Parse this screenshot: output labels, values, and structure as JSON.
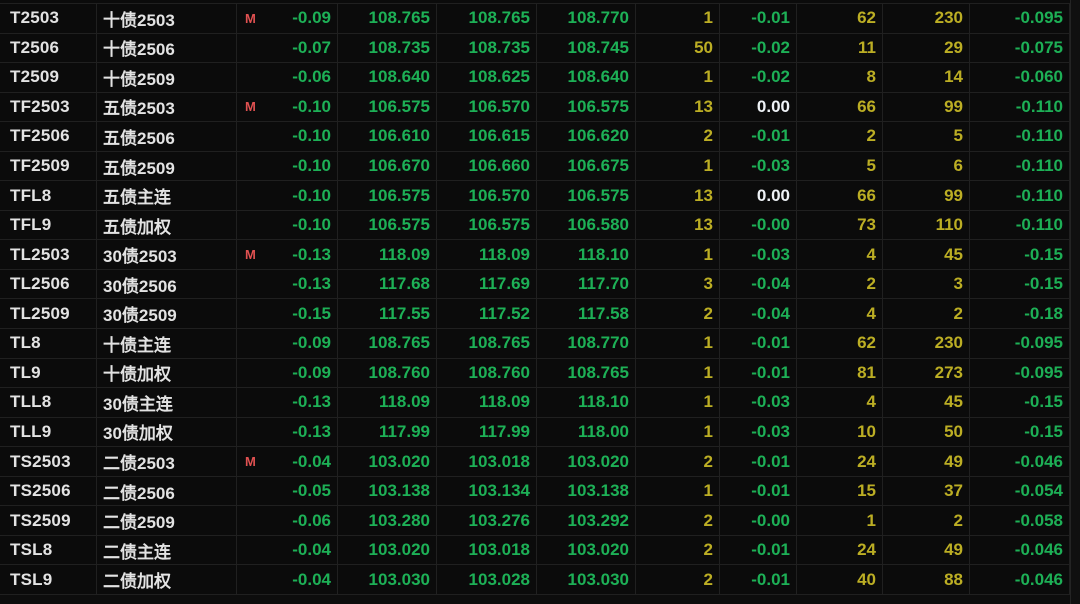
{
  "colors": {
    "background": "#0b0b0b",
    "grid_line": "#202020",
    "text_primary": "#e3e3e3",
    "down_green": "#1db056",
    "volume_yellow": "#bcae24",
    "zero_white": "#eef2f6",
    "marker_red": "#e05151",
    "scrollbar_track": "#101010",
    "footer": "#0d0d0d"
  },
  "marker_glyph": "M",
  "rows": [
    {
      "code": "T2503",
      "name": "十债2503",
      "marker": "M",
      "change": "-0.09",
      "price1": "108.765",
      "price2": "108.765",
      "price3": "108.770",
      "vol": "1",
      "change2": "-0.01",
      "num1": "62",
      "num2": "230",
      "change3": "-0.095"
    },
    {
      "code": "T2506",
      "name": "十债2506",
      "marker": "",
      "change": "-0.07",
      "price1": "108.735",
      "price2": "108.735",
      "price3": "108.745",
      "vol": "50",
      "change2": "-0.02",
      "num1": "11",
      "num2": "29",
      "change3": "-0.075"
    },
    {
      "code": "T2509",
      "name": "十债2509",
      "marker": "",
      "change": "-0.06",
      "price1": "108.640",
      "price2": "108.625",
      "price3": "108.640",
      "vol": "1",
      "change2": "-0.02",
      "num1": "8",
      "num2": "14",
      "change3": "-0.060"
    },
    {
      "code": "TF2503",
      "name": "五债2503",
      "marker": "M",
      "change": "-0.10",
      "price1": "106.575",
      "price2": "106.570",
      "price3": "106.575",
      "vol": "13",
      "change2": "0.00",
      "num1": "66",
      "num2": "99",
      "change3": "-0.110"
    },
    {
      "code": "TF2506",
      "name": "五债2506",
      "marker": "",
      "change": "-0.10",
      "price1": "106.610",
      "price2": "106.615",
      "price3": "106.620",
      "vol": "2",
      "change2": "-0.01",
      "num1": "2",
      "num2": "5",
      "change3": "-0.110"
    },
    {
      "code": "TF2509",
      "name": "五债2509",
      "marker": "",
      "change": "-0.10",
      "price1": "106.670",
      "price2": "106.660",
      "price3": "106.675",
      "vol": "1",
      "change2": "-0.03",
      "num1": "5",
      "num2": "6",
      "change3": "-0.110"
    },
    {
      "code": "TFL8",
      "name": "五债主连",
      "marker": "",
      "change": "-0.10",
      "price1": "106.575",
      "price2": "106.570",
      "price3": "106.575",
      "vol": "13",
      "change2": "0.00",
      "num1": "66",
      "num2": "99",
      "change3": "-0.110"
    },
    {
      "code": "TFL9",
      "name": "五债加权",
      "marker": "",
      "change": "-0.10",
      "price1": "106.575",
      "price2": "106.575",
      "price3": "106.580",
      "vol": "13",
      "change2": "-0.00",
      "num1": "73",
      "num2": "110",
      "change3": "-0.110"
    },
    {
      "code": "TL2503",
      "name": "30债2503",
      "marker": "M",
      "change": "-0.13",
      "price1": "118.09",
      "price2": "118.09",
      "price3": "118.10",
      "vol": "1",
      "change2": "-0.03",
      "num1": "4",
      "num2": "45",
      "change3": "-0.15"
    },
    {
      "code": "TL2506",
      "name": "30债2506",
      "marker": "",
      "change": "-0.13",
      "price1": "117.68",
      "price2": "117.69",
      "price3": "117.70",
      "vol": "3",
      "change2": "-0.04",
      "num1": "2",
      "num2": "3",
      "change3": "-0.15"
    },
    {
      "code": "TL2509",
      "name": "30债2509",
      "marker": "",
      "change": "-0.15",
      "price1": "117.55",
      "price2": "117.52",
      "price3": "117.58",
      "vol": "2",
      "change2": "-0.04",
      "num1": "4",
      "num2": "2",
      "change3": "-0.18"
    },
    {
      "code": "TL8",
      "name": "十债主连",
      "marker": "",
      "change": "-0.09",
      "price1": "108.765",
      "price2": "108.765",
      "price3": "108.770",
      "vol": "1",
      "change2": "-0.01",
      "num1": "62",
      "num2": "230",
      "change3": "-0.095"
    },
    {
      "code": "TL9",
      "name": "十债加权",
      "marker": "",
      "change": "-0.09",
      "price1": "108.760",
      "price2": "108.760",
      "price3": "108.765",
      "vol": "1",
      "change2": "-0.01",
      "num1": "81",
      "num2": "273",
      "change3": "-0.095"
    },
    {
      "code": "TLL8",
      "name": "30债主连",
      "marker": "",
      "change": "-0.13",
      "price1": "118.09",
      "price2": "118.09",
      "price3": "118.10",
      "vol": "1",
      "change2": "-0.03",
      "num1": "4",
      "num2": "45",
      "change3": "-0.15"
    },
    {
      "code": "TLL9",
      "name": "30债加权",
      "marker": "",
      "change": "-0.13",
      "price1": "117.99",
      "price2": "117.99",
      "price3": "118.00",
      "vol": "1",
      "change2": "-0.03",
      "num1": "10",
      "num2": "50",
      "change3": "-0.15"
    },
    {
      "code": "TS2503",
      "name": "二债2503",
      "marker": "M",
      "change": "-0.04",
      "price1": "103.020",
      "price2": "103.018",
      "price3": "103.020",
      "vol": "2",
      "change2": "-0.01",
      "num1": "24",
      "num2": "49",
      "change3": "-0.046"
    },
    {
      "code": "TS2506",
      "name": "二债2506",
      "marker": "",
      "change": "-0.05",
      "price1": "103.138",
      "price2": "103.134",
      "price3": "103.138",
      "vol": "1",
      "change2": "-0.01",
      "num1": "15",
      "num2": "37",
      "change3": "-0.054"
    },
    {
      "code": "TS2509",
      "name": "二债2509",
      "marker": "",
      "change": "-0.06",
      "price1": "103.280",
      "price2": "103.276",
      "price3": "103.292",
      "vol": "2",
      "change2": "-0.00",
      "num1": "1",
      "num2": "2",
      "change3": "-0.058"
    },
    {
      "code": "TSL8",
      "name": "二债主连",
      "marker": "",
      "change": "-0.04",
      "price1": "103.020",
      "price2": "103.018",
      "price3": "103.020",
      "vol": "2",
      "change2": "-0.01",
      "num1": "24",
      "num2": "49",
      "change3": "-0.046"
    },
    {
      "code": "TSL9",
      "name": "二债加权",
      "marker": "",
      "change": "-0.04",
      "price1": "103.030",
      "price2": "103.028",
      "price3": "103.030",
      "vol": "2",
      "change2": "-0.01",
      "num1": "40",
      "num2": "88",
      "change3": "-0.046"
    }
  ]
}
